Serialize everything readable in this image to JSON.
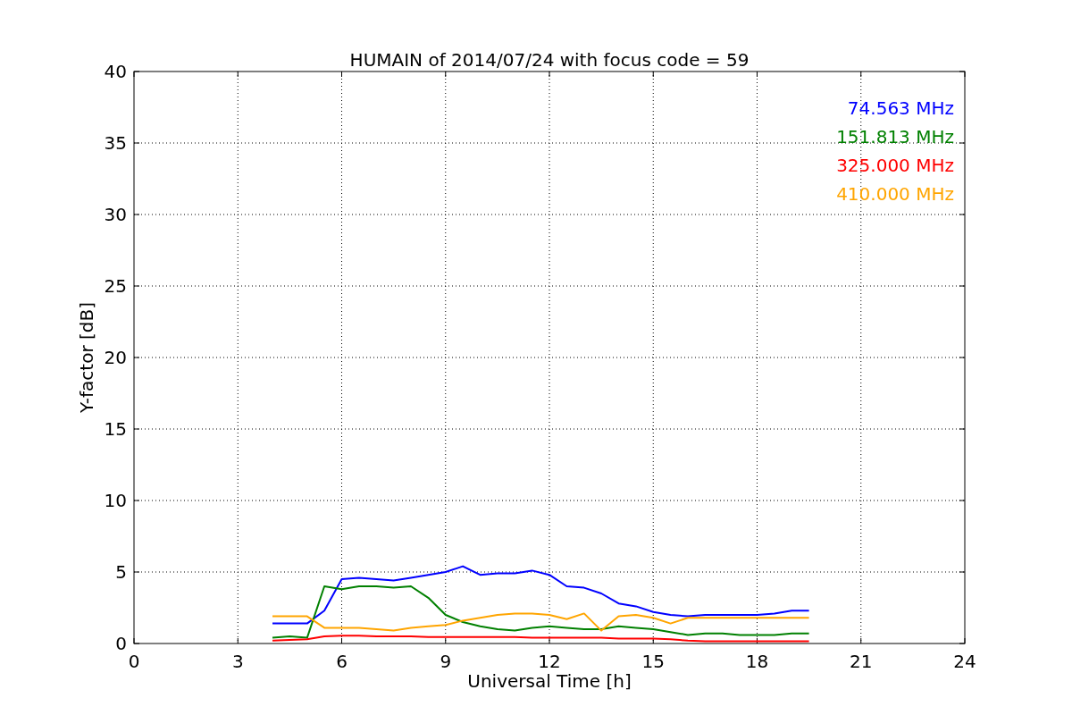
{
  "figure": {
    "chart_data": {
      "type": "line",
      "title": "HUMAIN of 2014/07/24 with focus code = 59",
      "xlabel": "Universal Time [h]",
      "ylabel": "Y-factor [dB]",
      "x": [
        4,
        4.5,
        5,
        5.5,
        6,
        6.5,
        7,
        7.5,
        8,
        8.5,
        9,
        9.5,
        10,
        10.5,
        11,
        11.5,
        12,
        12.5,
        13,
        13.5,
        14,
        14.5,
        15,
        15.5,
        16,
        16.5,
        17,
        17.5,
        18,
        18.5,
        19,
        19.5
      ],
      "series": [
        {
          "name": "74.563 MHz",
          "color": "#0000ff",
          "values": [
            1.4,
            1.4,
            1.4,
            2.3,
            4.5,
            4.6,
            4.5,
            4.4,
            4.6,
            4.8,
            5.0,
            5.4,
            4.8,
            4.9,
            4.9,
            5.1,
            4.8,
            4.0,
            3.9,
            3.5,
            2.8,
            2.6,
            2.2,
            2.0,
            1.9,
            2.0,
            2.0,
            2.0,
            2.0,
            2.1,
            2.3,
            2.3
          ]
        },
        {
          "name": "151.813 MHz",
          "color": "#008000",
          "values": [
            0.4,
            0.5,
            0.4,
            4.0,
            3.8,
            4.0,
            4.0,
            3.9,
            4.0,
            3.2,
            2.0,
            1.5,
            1.2,
            1.0,
            0.9,
            1.1,
            1.2,
            1.1,
            1.0,
            1.0,
            1.2,
            1.1,
            1.0,
            0.8,
            0.6,
            0.7,
            0.7,
            0.6,
            0.6,
            0.6,
            0.7,
            0.7
          ]
        },
        {
          "name": "325.000 MHz",
          "color": "#ff0000",
          "values": [
            0.2,
            0.25,
            0.3,
            0.5,
            0.55,
            0.55,
            0.5,
            0.5,
            0.5,
            0.45,
            0.45,
            0.45,
            0.45,
            0.45,
            0.45,
            0.4,
            0.4,
            0.4,
            0.4,
            0.4,
            0.35,
            0.35,
            0.35,
            0.3,
            0.2,
            0.15,
            0.15,
            0.15,
            0.15,
            0.15,
            0.15,
            0.15
          ]
        },
        {
          "name": "410.000 MHz",
          "color": "#ffa500",
          "values": [
            1.9,
            1.9,
            1.9,
            1.1,
            1.1,
            1.1,
            1.0,
            0.9,
            1.1,
            1.2,
            1.3,
            1.6,
            1.8,
            2.0,
            2.1,
            2.1,
            2.0,
            1.7,
            2.1,
            0.9,
            1.9,
            2.0,
            1.8,
            1.4,
            1.8,
            1.8,
            1.8,
            1.8,
            1.8,
            1.8,
            1.8,
            1.8
          ]
        }
      ],
      "grid": true,
      "xlim": [
        0,
        24
      ],
      "ylim": [
        0,
        40
      ],
      "xticks": [
        0,
        3,
        6,
        9,
        12,
        15,
        18,
        21,
        24
      ],
      "yticks": [
        0,
        5,
        10,
        15,
        20,
        25,
        30,
        35,
        40
      ]
    }
  }
}
